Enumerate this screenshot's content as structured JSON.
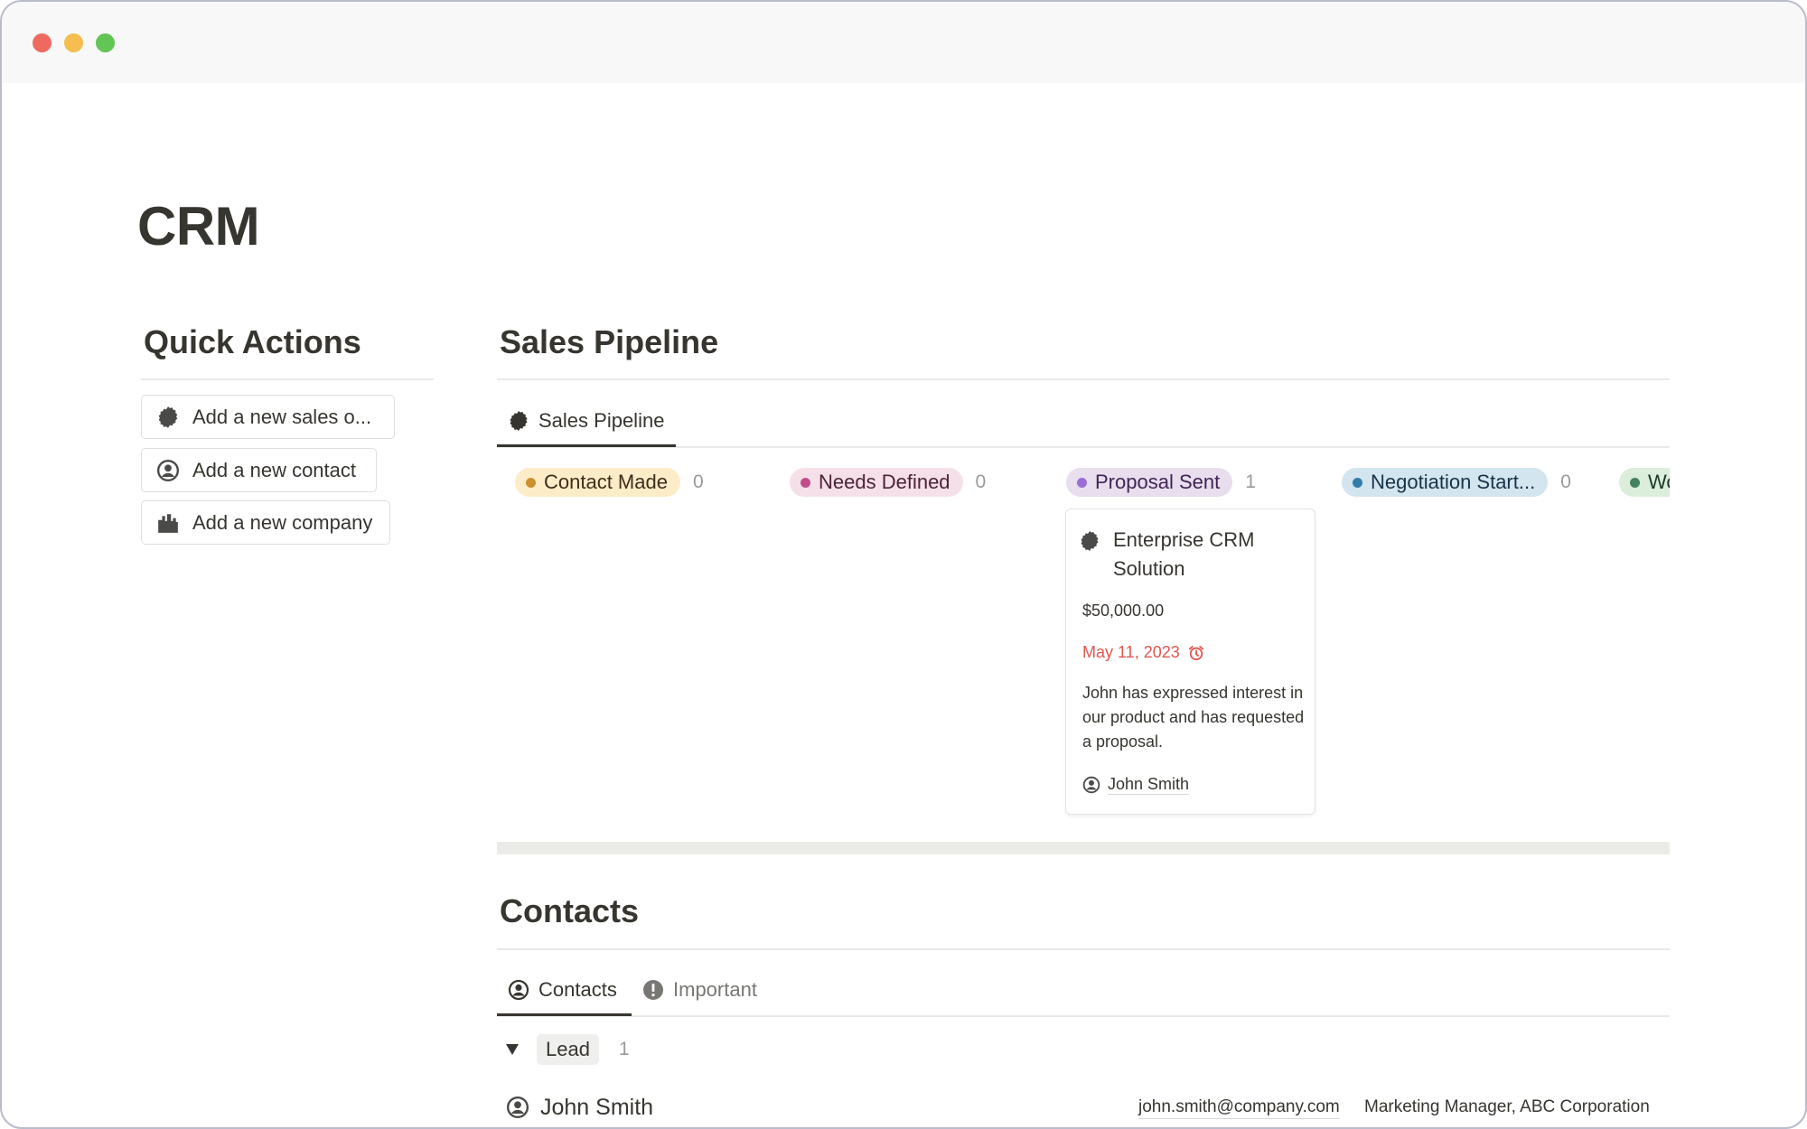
{
  "window": {
    "controls": [
      "close",
      "minimize",
      "maximize"
    ]
  },
  "page": {
    "title": "CRM"
  },
  "quick_actions": {
    "heading": "Quick Actions",
    "buttons": [
      {
        "label": "Add a new sales o...",
        "icon": "sales-badge-icon"
      },
      {
        "label": "Add a new contact",
        "icon": "person-circle-icon"
      },
      {
        "label": "Add a new company",
        "icon": "building-icon"
      }
    ]
  },
  "sales_pipeline": {
    "heading": "Sales Pipeline",
    "tabs": [
      {
        "label": "Sales Pipeline",
        "icon": "sales-badge-icon",
        "active": true
      }
    ],
    "columns": [
      {
        "label": "Contact Made",
        "count": "0",
        "bg": "#fdecc8",
        "dot": "#cb912f",
        "text": "#402c1b"
      },
      {
        "label": "Needs Defined",
        "count": "0",
        "bg": "#f5e0e9",
        "dot": "#c14c8a",
        "text": "#4c2337"
      },
      {
        "label": "Proposal Sent",
        "count": "1",
        "bg": "#e8deee",
        "dot": "#9a6dd7",
        "text": "#412454"
      },
      {
        "label": "Negotiation Start...",
        "count": "0",
        "bg": "#d3e5ef",
        "dot": "#337ea9",
        "text": "#183347"
      },
      {
        "label": "Wo",
        "count": "",
        "bg": "#dbeddb",
        "dot": "#448361",
        "text": "#1c3829"
      }
    ],
    "card": {
      "title": "Enterprise CRM Solution",
      "amount": "$50,000.00",
      "date": "May 11, 2023",
      "date_color": "#e2564f",
      "description": "John has expressed interest in our product and has requested a proposal.",
      "person": "John Smith"
    }
  },
  "contacts": {
    "heading": "Contacts",
    "tabs": [
      {
        "label": "Contacts",
        "icon": "person-circle-icon",
        "active": true
      },
      {
        "label": "Important",
        "icon": "exclamation-circle-icon",
        "active": false
      }
    ],
    "groups": [
      {
        "label": "Lead",
        "count": "1",
        "rows": [
          {
            "name": "John Smith",
            "email": "john.smith@company.com",
            "role": "Marketing Manager, ABC Corporation"
          }
        ]
      }
    ]
  }
}
